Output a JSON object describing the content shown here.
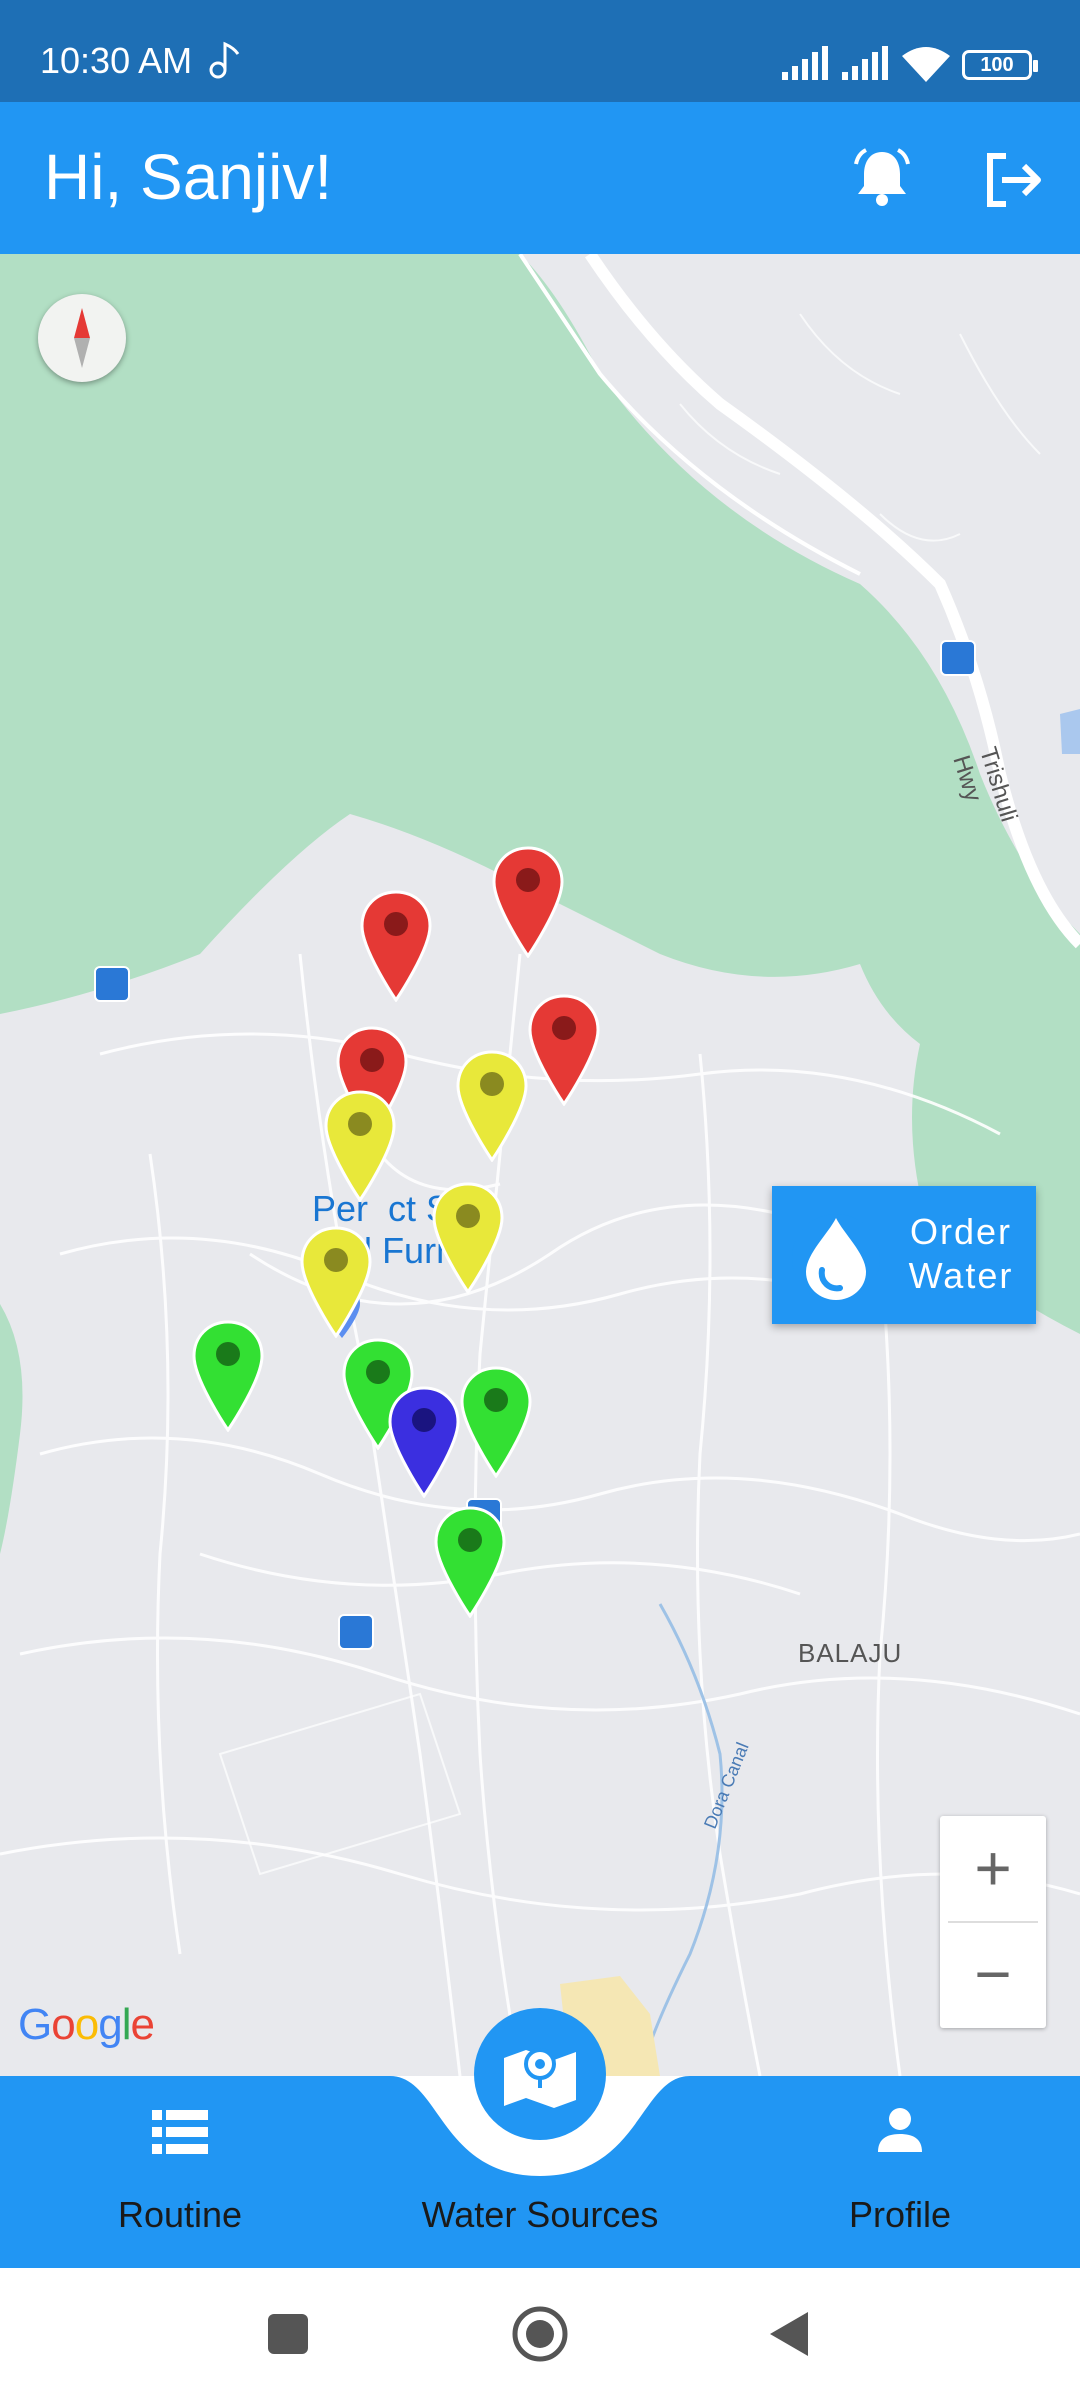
{
  "status_bar": {
    "time": "10:30 AM",
    "battery": "100",
    "icons": [
      "music-note-icon",
      "signal-icon",
      "signal-icon",
      "wifi-icon",
      "battery-icon"
    ]
  },
  "app_bar": {
    "greeting": "Hi, Sanjiv!",
    "icons": [
      "bell-icon",
      "logout-icon"
    ]
  },
  "map": {
    "poi_label": "Perfect Sofa and Furniture",
    "poi_label_visible": "Per  ct Sofa\nand Furni",
    "place_label": "BALAJU",
    "canal_label": "Dora Canal",
    "highway_label": "Trishuli Hwy",
    "attribution": "Google",
    "zoom_in": "+",
    "zoom_out": "−",
    "markers": [
      {
        "status": "red"
      },
      {
        "status": "red"
      },
      {
        "status": "red"
      },
      {
        "status": "red"
      },
      {
        "status": "yellow"
      },
      {
        "status": "yellow"
      },
      {
        "status": "yellow"
      },
      {
        "status": "yellow"
      },
      {
        "status": "green"
      },
      {
        "status": "green"
      },
      {
        "status": "green"
      },
      {
        "status": "green"
      },
      {
        "status": "blue"
      }
    ],
    "order_button": {
      "line1": "Order",
      "line2": "Water"
    }
  },
  "bottom_nav": {
    "items": [
      {
        "label": "Routine",
        "icon": "list-icon"
      },
      {
        "label": "Water Sources",
        "icon": "map-icon"
      },
      {
        "label": "Profile",
        "icon": "person-icon"
      }
    ]
  },
  "colors": {
    "status_bar": "#1E6FB5",
    "primary": "#2196F3",
    "marker_red": "#E53935",
    "marker_yellow": "#E8E83A",
    "marker_green": "#33E033",
    "marker_blue": "#3B2FE0",
    "map_green": "#b2dfc4",
    "map_land": "#e8e9ed"
  }
}
